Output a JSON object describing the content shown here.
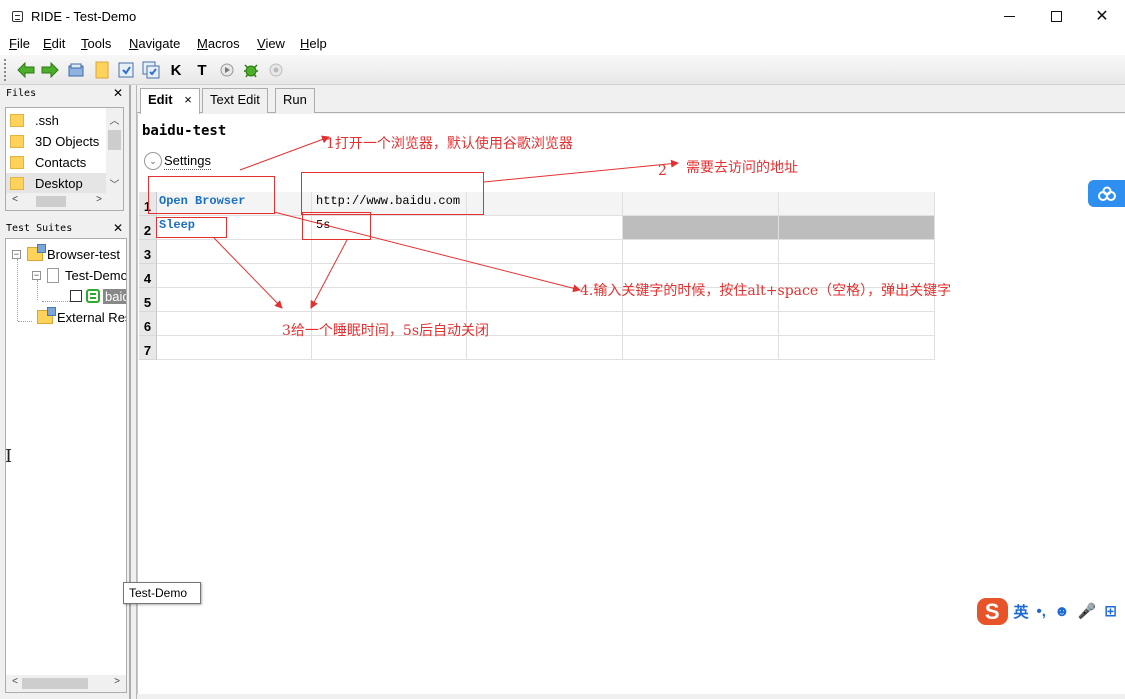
{
  "window": {
    "title": "RIDE - Test-Demo",
    "controls": {
      "minimize": "—",
      "maximize": "☐",
      "close": "✕"
    }
  },
  "menu": {
    "items": [
      {
        "label": "File",
        "mnemonic": "F"
      },
      {
        "label": "Edit",
        "mnemonic": "E"
      },
      {
        "label": "Tools",
        "mnemonic": "T"
      },
      {
        "label": "Navigate",
        "mnemonic": "N"
      },
      {
        "label": "Macros",
        "mnemonic": "M"
      },
      {
        "label": "View",
        "mnemonic": "V"
      },
      {
        "label": "Help",
        "mnemonic": "H"
      }
    ]
  },
  "toolbar": {
    "icons": [
      "back-arrow-icon",
      "forward-arrow-icon",
      "open-suite-icon",
      "open-directory-icon",
      "save-icon",
      "save-all-icon",
      "search-keywords-icon",
      "search-tests-icon",
      "run-icon",
      "debug-icon",
      "stop-icon"
    ],
    "k_label": "K",
    "t_label": "T"
  },
  "files_panel": {
    "title": "Files",
    "close": "✕",
    "items": [
      {
        "label": ".ssh",
        "selected": false
      },
      {
        "label": "3D Objects",
        "selected": false
      },
      {
        "label": "Contacts",
        "selected": false
      },
      {
        "label": "Desktop",
        "selected": true
      }
    ]
  },
  "suites_panel": {
    "title": "Test Suites",
    "close": "✕",
    "tree": {
      "root": "Browser-test",
      "suite": "Test-Demo",
      "test_case": "baidu-test",
      "external": "External Resources"
    }
  },
  "tabs": [
    {
      "label": "Edit",
      "active": true,
      "close": "×"
    },
    {
      "label": "Text Edit",
      "active": false
    },
    {
      "label": "Run",
      "active": false
    }
  ],
  "editor": {
    "test_name": "baidu-test",
    "settings_label": "Settings",
    "rows": [
      {
        "num": "1",
        "keyword": "Open Browser",
        "arg1": "http://www.baidu.com",
        "arg2": "",
        "arg3": "",
        "arg4": ""
      },
      {
        "num": "2",
        "keyword": "Sleep",
        "arg1": "5s",
        "arg2": "",
        "arg3": "",
        "arg4": ""
      },
      {
        "num": "3",
        "keyword": "",
        "arg1": "",
        "arg2": "",
        "arg3": "",
        "arg4": ""
      },
      {
        "num": "4",
        "keyword": "",
        "arg1": "",
        "arg2": "",
        "arg3": "",
        "arg4": ""
      },
      {
        "num": "5",
        "keyword": "",
        "arg1": "",
        "arg2": "",
        "arg3": "",
        "arg4": ""
      },
      {
        "num": "6",
        "keyword": "",
        "arg1": "",
        "arg2": "",
        "arg3": "",
        "arg4": ""
      },
      {
        "num": "7",
        "keyword": "",
        "arg1": "",
        "arg2": "",
        "arg3": "",
        "arg4": ""
      }
    ]
  },
  "annotations": {
    "a1": "1打开一个浏览器，默认使用谷歌浏览器",
    "a2_num": "2",
    "a2_text": "需要去访问的地址",
    "a3": "3给一个睡眠时间，5s后自动关闭",
    "a4": "4.输入关键字的时候，按住alt+space（空格），弹出关键字",
    "color": "#e53030"
  },
  "tooltip": {
    "text": "Test-Demo"
  },
  "ime": {
    "lang": "英",
    "punct": "•,",
    "emoji": "☻",
    "mic": "🎤",
    "more": "⊞"
  }
}
